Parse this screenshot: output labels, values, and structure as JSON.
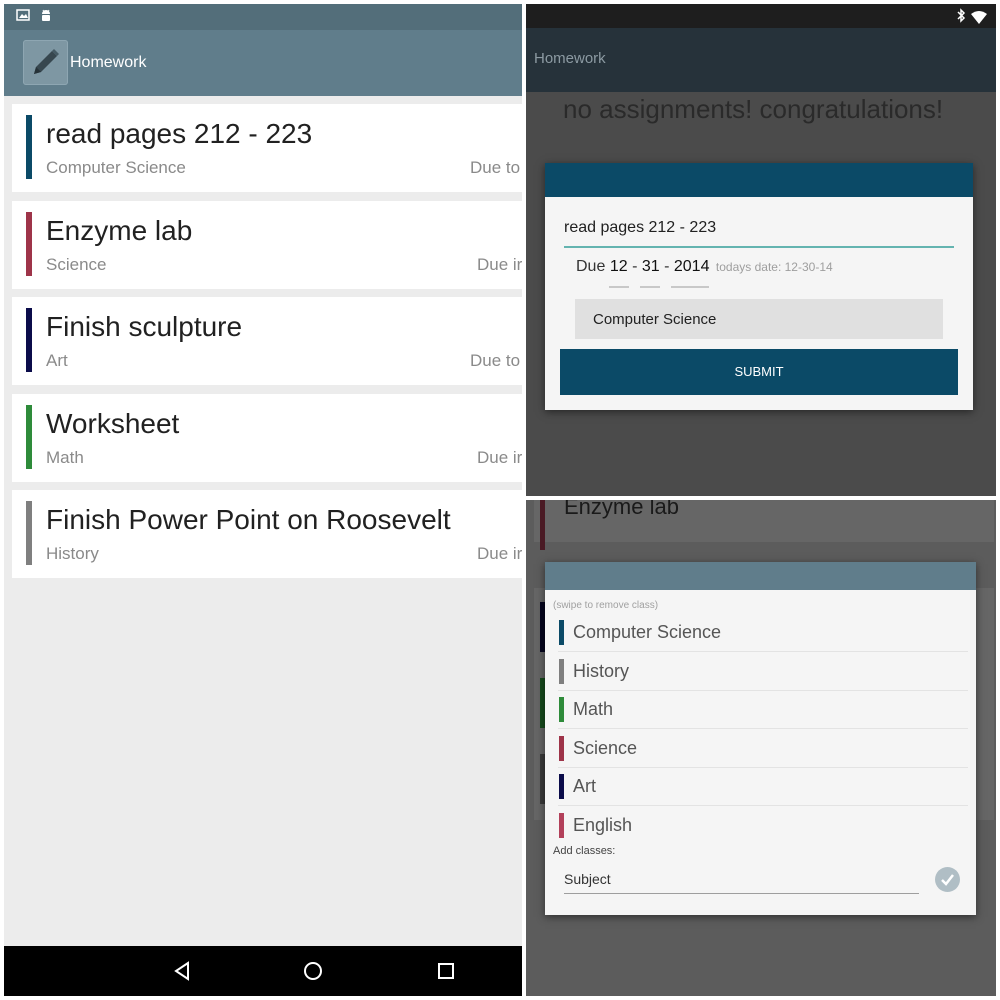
{
  "left": {
    "app_title": "Homework",
    "assignments": [
      {
        "title": "read pages 212 - 223",
        "subject": "Computer Science",
        "due": "Due to",
        "color": "#0b4a67"
      },
      {
        "title": "Enzyme lab",
        "subject": "Science",
        "due": "Due ir",
        "color": "#9e3449"
      },
      {
        "title": "Finish sculpture",
        "subject": "Art",
        "due": "Due to",
        "color": "#0b0c4a"
      },
      {
        "title": "Worksheet",
        "subject": "Math",
        "due": "Due ir",
        "color": "#2e8b3a"
      },
      {
        "title": "Finish Power Point on Roosevelt",
        "subject": "History",
        "due": "Due ir",
        "color": "#7f7f7f"
      }
    ],
    "status_icons": [
      "image-icon",
      "android-icon"
    ],
    "nav_icons": [
      "back-icon",
      "home-icon",
      "recents-icon"
    ]
  },
  "right_top": {
    "app_title": "Homework",
    "empty_message": "no assignments! congratulations!",
    "dialog": {
      "assignment_value": "read pages 212 - 223",
      "due_label": "Due",
      "month": "12",
      "day": "31",
      "year": "2014",
      "sep": "-",
      "today_label": "todays date: 12-30-14",
      "class_value": "Computer Science",
      "submit_label": "SUBMIT"
    },
    "status_icons": [
      "bluetooth-icon",
      "wifi-icon"
    ]
  },
  "right_bottom": {
    "background_title": "Enzyme lab",
    "dialog": {
      "hint": "(swipe to remove class)",
      "classes": [
        {
          "name": "Computer Science",
          "color": "#0b4a67"
        },
        {
          "name": "History",
          "color": "#7f7f7f"
        },
        {
          "name": "Math",
          "color": "#2e8b3a"
        },
        {
          "name": "Science",
          "color": "#9e3449"
        },
        {
          "name": "Art",
          "color": "#0b0c4a"
        },
        {
          "name": "English",
          "color": "#b2405a"
        }
      ],
      "add_label": "Add classes:",
      "subject_value": "Subject"
    }
  }
}
